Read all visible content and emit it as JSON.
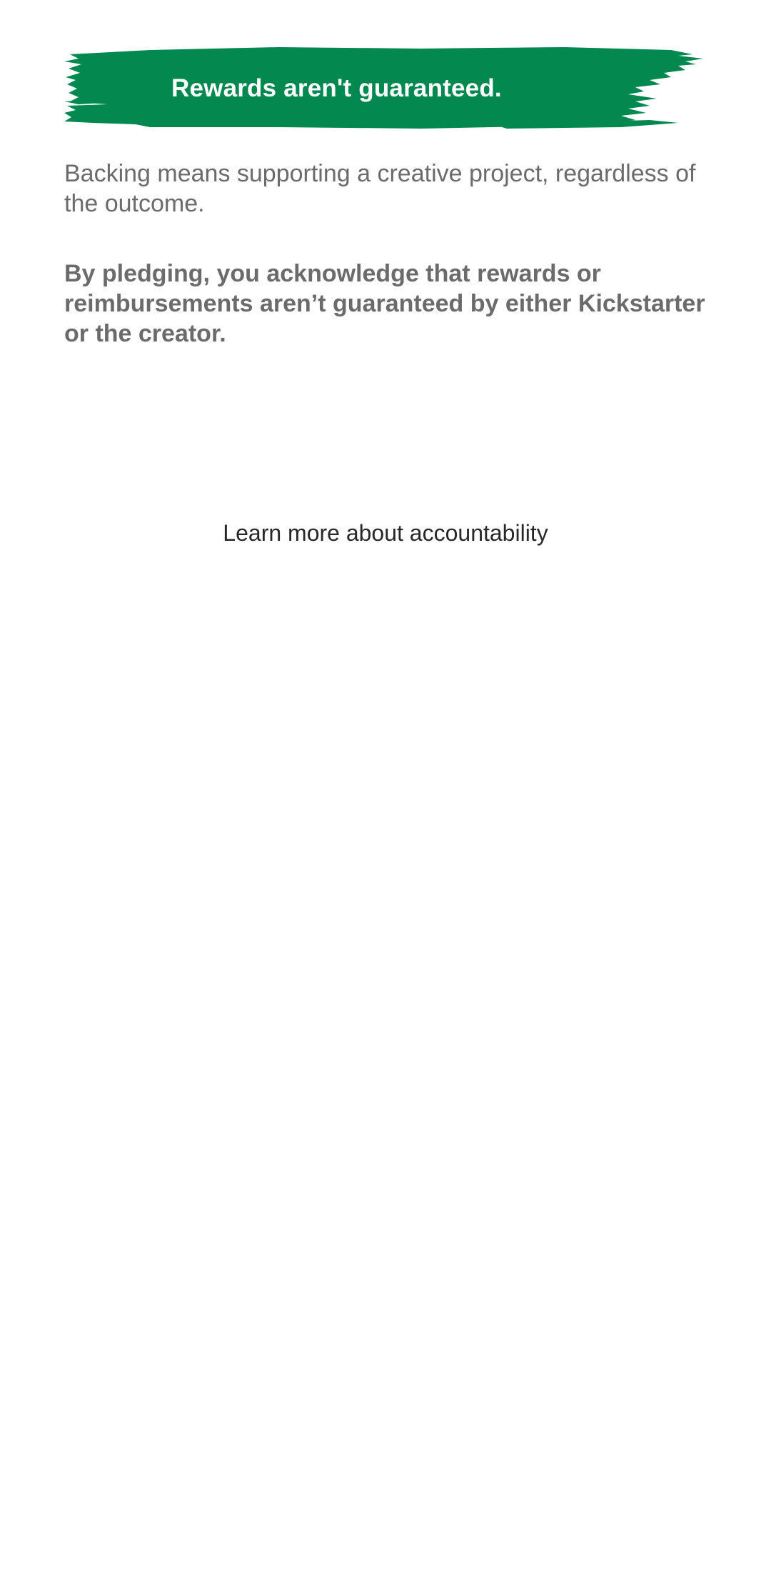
{
  "banner": {
    "title": "Rewards aren't guaranteed.",
    "color": "#03884F"
  },
  "body": {
    "intro": "Backing means supporting a creative project, regardless of the outcome.",
    "acknowledgement": "By pledging, you acknowledge that rewards or reimbursements aren’t guaranteed by either Kickstarter or the creator."
  },
  "links": {
    "learn_more": "Learn more about accountability"
  }
}
